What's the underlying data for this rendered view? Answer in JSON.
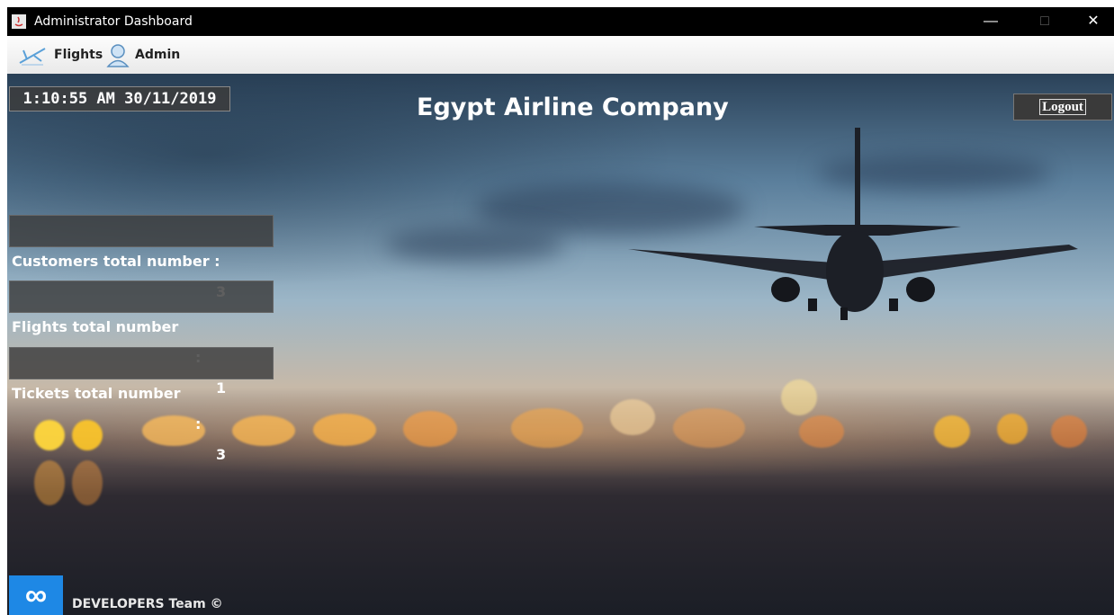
{
  "window": {
    "title": "Administrator Dashboard",
    "minimize": "—",
    "maximize": "□",
    "close": "✕"
  },
  "menu": {
    "flights": "Flights",
    "admin": "Admin"
  },
  "clock": "1:10:55 AM 30/11/2019",
  "company_title": "Egypt Airline Company",
  "logout_label": "Logout",
  "stats": {
    "customers": {
      "label": "Customers total number :",
      "value": "3"
    },
    "flights": {
      "label": "Flights total number",
      "sep": ":",
      "value": "1"
    },
    "tickets": {
      "label": "Tickets total number",
      "sep": ":",
      "value": "3"
    }
  },
  "footer": {
    "logo": "∞",
    "text": "DEVELOPERS Team ©"
  },
  "colors": {
    "titlebar": "#000000",
    "logo_blue": "#1e88e5",
    "panel": "#3c3c3c"
  }
}
